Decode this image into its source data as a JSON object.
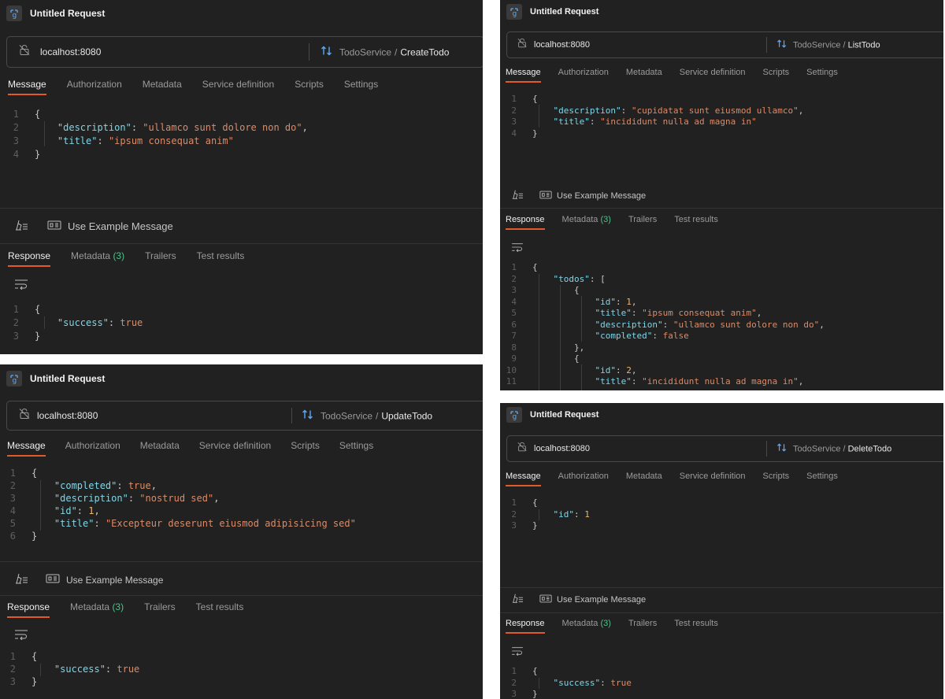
{
  "app": {
    "title": "Untitled Request"
  },
  "icons": {
    "app": "grpc-icon",
    "url": "no-tls-lock-icon",
    "method": "sort-arrows-icon",
    "beautify": "beautify-icon",
    "example": "example-message-icon",
    "wrap": "wrap-lines-icon"
  },
  "url": "localhost:8080",
  "service": "TodoService",
  "request_tabs": [
    "Message",
    "Authorization",
    "Metadata",
    "Service definition",
    "Scripts",
    "Settings"
  ],
  "response_tabs": {
    "response": "Response",
    "metadata": "Metadata",
    "metadata_count": "(3)",
    "trailers": "Trailers",
    "test_results": "Test results"
  },
  "use_example": "Use Example Message",
  "colors": {
    "accent": "#e05a2b",
    "count": "#4cc38a",
    "key": "#7fd6e8",
    "string": "#d98c6b",
    "number": "#e8b676"
  },
  "panels": {
    "create": {
      "method": "CreateTodo",
      "message": [
        {
          "n": "1",
          "parts": [
            [
              "p",
              "{"
            ]
          ]
        },
        {
          "n": "2",
          "parts": [
            [
              "k",
              "    \"description\""
            ],
            [
              "p",
              ": "
            ],
            [
              "s",
              "\"ullamco sunt dolore non do\""
            ],
            [
              "p",
              ","
            ]
          ]
        },
        {
          "n": "3",
          "parts": [
            [
              "k",
              "    \"title\""
            ],
            [
              "p",
              ": "
            ],
            [
              "s",
              "\"ipsum consequat anim\""
            ]
          ]
        },
        {
          "n": "4",
          "parts": [
            [
              "p",
              "}"
            ]
          ]
        }
      ],
      "response": [
        {
          "n": "1",
          "parts": [
            [
              "p",
              "{"
            ]
          ]
        },
        {
          "n": "2",
          "parts": [
            [
              "k",
              "    \"success\""
            ],
            [
              "p",
              ": "
            ],
            [
              "b",
              "true"
            ]
          ]
        },
        {
          "n": "3",
          "parts": [
            [
              "p",
              "}"
            ]
          ]
        }
      ]
    },
    "list": {
      "method": "ListTodo",
      "message": [
        {
          "n": "1",
          "parts": [
            [
              "p",
              "{"
            ]
          ]
        },
        {
          "n": "2",
          "parts": [
            [
              "k",
              "    \"description\""
            ],
            [
              "p",
              ": "
            ],
            [
              "s",
              "\"cupidatat sunt eiusmod ullamco\""
            ],
            [
              "p",
              ","
            ]
          ]
        },
        {
          "n": "3",
          "parts": [
            [
              "k",
              "    \"title\""
            ],
            [
              "p",
              ": "
            ],
            [
              "s",
              "\"incididunt nulla ad magna in\""
            ]
          ]
        },
        {
          "n": "4",
          "parts": [
            [
              "p",
              "}"
            ]
          ]
        }
      ],
      "response": [
        {
          "n": "1",
          "parts": [
            [
              "p",
              "{"
            ]
          ]
        },
        {
          "n": "2",
          "parts": [
            [
              "k",
              "    \"todos\""
            ],
            [
              "p",
              ": ["
            ]
          ]
        },
        {
          "n": "3",
          "parts": [
            [
              "p",
              "        {"
            ]
          ]
        },
        {
          "n": "4",
          "parts": [
            [
              "k",
              "            \"id\""
            ],
            [
              "p",
              ": "
            ],
            [
              "n",
              "1"
            ],
            [
              "p",
              ","
            ]
          ]
        },
        {
          "n": "5",
          "parts": [
            [
              "k",
              "            \"title\""
            ],
            [
              "p",
              ": "
            ],
            [
              "s",
              "\"ipsum consequat anim\""
            ],
            [
              "p",
              ","
            ]
          ]
        },
        {
          "n": "6",
          "parts": [
            [
              "k",
              "            \"description\""
            ],
            [
              "p",
              ": "
            ],
            [
              "s",
              "\"ullamco sunt dolore non do\""
            ],
            [
              "p",
              ","
            ]
          ]
        },
        {
          "n": "7",
          "parts": [
            [
              "k",
              "            \"completed\""
            ],
            [
              "p",
              ": "
            ],
            [
              "b",
              "false"
            ]
          ]
        },
        {
          "n": "8",
          "parts": [
            [
              "p",
              "        },"
            ]
          ]
        },
        {
          "n": "9",
          "parts": [
            [
              "p",
              "        {"
            ]
          ]
        },
        {
          "n": "10",
          "parts": [
            [
              "k",
              "            \"id\""
            ],
            [
              "p",
              ": "
            ],
            [
              "n",
              "2"
            ],
            [
              "p",
              ","
            ]
          ]
        },
        {
          "n": "11",
          "parts": [
            [
              "k",
              "            \"title\""
            ],
            [
              "p",
              ": "
            ],
            [
              "s",
              "\"incididunt nulla ad magna in\""
            ],
            [
              "p",
              ","
            ]
          ]
        }
      ]
    },
    "update": {
      "method": "UpdateTodo",
      "message": [
        {
          "n": "1",
          "parts": [
            [
              "p",
              "{"
            ]
          ]
        },
        {
          "n": "2",
          "parts": [
            [
              "k",
              "    \"completed\""
            ],
            [
              "p",
              ": "
            ],
            [
              "b",
              "true"
            ],
            [
              "p",
              ","
            ]
          ]
        },
        {
          "n": "3",
          "parts": [
            [
              "k",
              "    \"description\""
            ],
            [
              "p",
              ": "
            ],
            [
              "s",
              "\"nostrud sed\""
            ],
            [
              "p",
              ","
            ]
          ]
        },
        {
          "n": "4",
          "parts": [
            [
              "k",
              "    \"id\""
            ],
            [
              "p",
              ": "
            ],
            [
              "n",
              "1"
            ],
            [
              "p",
              ","
            ]
          ]
        },
        {
          "n": "5",
          "parts": [
            [
              "k",
              "    \"title\""
            ],
            [
              "p",
              ": "
            ],
            [
              "s",
              "\"Excepteur deserunt eiusmod adipisicing sed\""
            ]
          ]
        },
        {
          "n": "6",
          "parts": [
            [
              "p",
              "}"
            ]
          ]
        }
      ],
      "response": [
        {
          "n": "1",
          "parts": [
            [
              "p",
              "{"
            ]
          ]
        },
        {
          "n": "2",
          "parts": [
            [
              "k",
              "    \"success\""
            ],
            [
              "p",
              ": "
            ],
            [
              "b",
              "true"
            ]
          ]
        },
        {
          "n": "3",
          "parts": [
            [
              "p",
              "}"
            ]
          ]
        }
      ]
    },
    "delete": {
      "method": "DeleteTodo",
      "message": [
        {
          "n": "1",
          "parts": [
            [
              "p",
              "{"
            ]
          ]
        },
        {
          "n": "2",
          "parts": [
            [
              "k",
              "    \"id\""
            ],
            [
              "p",
              ": "
            ],
            [
              "n",
              "1"
            ]
          ]
        },
        {
          "n": "3",
          "parts": [
            [
              "p",
              "}"
            ]
          ]
        }
      ],
      "response": [
        {
          "n": "1",
          "parts": [
            [
              "p",
              "{"
            ]
          ]
        },
        {
          "n": "2",
          "parts": [
            [
              "k",
              "    \"success\""
            ],
            [
              "p",
              ": "
            ],
            [
              "b",
              "true"
            ]
          ]
        },
        {
          "n": "3",
          "parts": [
            [
              "p",
              "}"
            ]
          ]
        }
      ]
    }
  }
}
